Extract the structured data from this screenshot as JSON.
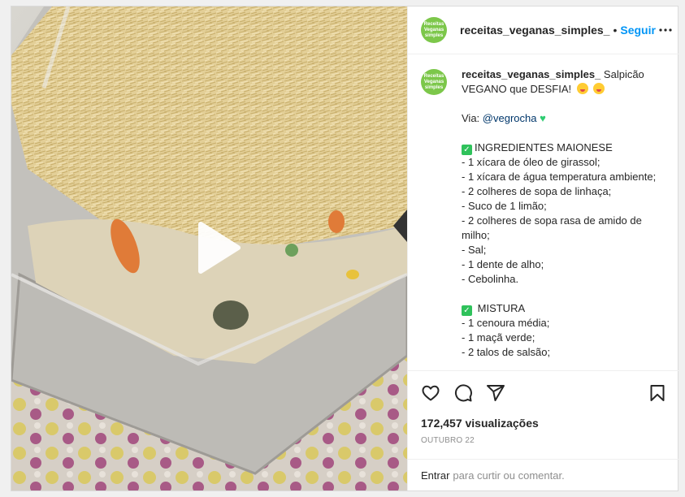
{
  "post": {
    "username": "receitas_veganas_simples_",
    "follow_label": "Seguir",
    "separator": "•",
    "avatar_text": [
      "Receitas",
      "Veganas"
    ],
    "avatar_subtext": "simples"
  },
  "caption": {
    "username": "receitas_veganas_simples_",
    "title": "Salpicão VEGANO que DESFIA!",
    "via_label": "Via:",
    "mention": "@vegrocha",
    "section1_title": "INGREDIENTES MAIONESE",
    "section1_items": [
      "- 1 xícara de óleo de girassol;",
      "- 1 xícara de água temperatura ambiente;",
      "- 2 colheres de sopa de linhaça;",
      "- Suco de 1 limão;",
      "- 2 colheres de sopa rasa de amido de milho;",
      "- Sal;",
      "- 1 dente de alho;",
      "- Cebolinha."
    ],
    "section2_title": "MISTURA",
    "section2_items": [
      "- 1 cenoura média;",
      "- 1 maçã verde;",
      "- 2 talos de salsão;"
    ]
  },
  "stats": {
    "views_count": "172,457",
    "views_label": "visualizações",
    "date": "OUTUBRO 22"
  },
  "footer": {
    "login_label": "Entrar",
    "login_suffix": "para curtir ou comentar."
  },
  "icons": {
    "play": "play-icon",
    "more": "more-options-icon",
    "like": "heart-icon",
    "comment": "comment-icon",
    "share": "share-icon",
    "save": "bookmark-icon"
  },
  "colors": {
    "accent": "#0095f6",
    "avatar_green": "#7cc74a",
    "emoji_green": "#2fc25b"
  }
}
